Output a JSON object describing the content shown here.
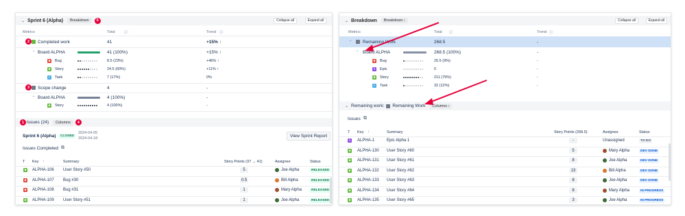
{
  "left": {
    "header": {
      "title": "Sprint 6 (Alpha)",
      "breakdown_label": "Breakdown",
      "collapse_all": "Collapse all",
      "expand_all": "Expand all"
    },
    "badges": {
      "b1": "1",
      "b2": "2",
      "b3": "3",
      "b4": "4",
      "b5": "5"
    },
    "cols": {
      "metrics": "Metrics",
      "total": "Total",
      "trend": "Trend"
    },
    "completed": {
      "label": "Completed work",
      "total": "41",
      "trend": "+15% ↑",
      "board": {
        "label": "Board ALPHA",
        "total": "41 (100%)",
        "trend": "+15% ↑"
      },
      "rows": [
        {
          "label": "Bug",
          "total": "8.5 (23%)",
          "trend": "+46% ↑"
        },
        {
          "label": "Story",
          "total": "24.5 (60%)",
          "trend": "+11% ↑"
        },
        {
          "label": "Task",
          "total": "7 (17%)",
          "trend": "0%"
        }
      ]
    },
    "scope": {
      "label": "Scope change",
      "total": "4",
      "trend": "-",
      "board": {
        "label": "Board ALPHA",
        "total": "4 (100%)",
        "trend": "-"
      },
      "rows": [
        {
          "label": "Story",
          "total": "4 (100%)",
          "trend": "-"
        }
      ]
    },
    "tabs": {
      "issues": "Issues (24)",
      "columns": "Columns"
    },
    "sprint": {
      "name": "Sprint 6 (Alpha)",
      "status": "CLOSED",
      "start": "2024-04-05",
      "end": "2024-04-18",
      "report": "View Sprint Report"
    },
    "completed_title": "Issues Completed",
    "thead": {
      "t": "T",
      "key": "Key",
      "summary": "Summary",
      "points": "Story Points (37 → 41)",
      "assignee": "Assignee",
      "status": "Status"
    },
    "issues": [
      {
        "key": "ALPHA-106",
        "summary": "User Story #50",
        "points": "5",
        "assignee": "Joe Alpha",
        "status": "RELEASED"
      },
      {
        "key": "ALPHA-107",
        "summary": "Bug #30",
        "points": "0.5",
        "assignee": "Bill Alpha",
        "status": "RELEASED"
      },
      {
        "key": "ALPHA-108",
        "summary": "Bug #31",
        "points": "1",
        "assignee": "Mary Alpha",
        "status": "RELEASED"
      },
      {
        "key": "ALPHA-109",
        "summary": "User Story #51",
        "points": "1",
        "assignee": "Joe Alpha",
        "status": "RELEASED"
      }
    ]
  },
  "right": {
    "header": {
      "title": "Breakdown",
      "breakdown_label": "Breakdown",
      "collapse_all": "Collapse all",
      "expand_all": "Expand all"
    },
    "cols": {
      "metrics": "Metrics",
      "total": "Total",
      "trend": "Trend"
    },
    "remaining": {
      "label": "Remaining Work",
      "total": "268.5",
      "trend": "-",
      "board": {
        "label": "Board ALPHA",
        "total": "268.5 (100%)",
        "trend": "-"
      },
      "rows": [
        {
          "label": "Bug",
          "total": "25.5 (9%)",
          "trend": "-"
        },
        {
          "label": "Epic",
          "total": "0",
          "trend": "-"
        },
        {
          "label": "Story",
          "total": "211 (79%)",
          "trend": "-"
        },
        {
          "label": "Task",
          "total": "32 (12%)",
          "trend": "-"
        }
      ]
    },
    "sub": {
      "prefix": "Remaining work:",
      "label": "Remaining Work",
      "columns": "Columns"
    },
    "issues_title": "Issues",
    "thead": {
      "t": "T",
      "key": "Key",
      "summary": "Summary",
      "points": "Story Points (268.5)",
      "assignee": "Assignee",
      "status": "Status"
    },
    "issues": [
      {
        "key": "ALPHA-1",
        "summary": "Epic Alpha 1",
        "points": "-",
        "assignee": "Unassigned",
        "status": "TO DO"
      },
      {
        "key": "ALPHA-130",
        "summary": "User Story #60",
        "points": "5",
        "assignee": "Mary Alpha",
        "status": "DEV DONE"
      },
      {
        "key": "ALPHA-131",
        "summary": "User Story #61",
        "points": "8",
        "assignee": "Joe Alpha",
        "status": "DEV DONE"
      },
      {
        "key": "ALPHA-132",
        "summary": "User Story #62",
        "points": "13",
        "assignee": "Bill Alpha",
        "status": "DEV DONE"
      },
      {
        "key": "ALPHA-133",
        "summary": "User Story #63",
        "points": "8",
        "assignee": "Joe Alpha",
        "status": "DEV DONE"
      },
      {
        "key": "ALPHA-134",
        "summary": "User Story #64",
        "points": "8",
        "assignee": "Mary Alpha",
        "status": "IN PROGRESS"
      },
      {
        "key": "ALPHA-135",
        "summary": "User Story #65",
        "points": "3",
        "assignee": "Joe Alpha",
        "status": "IN PROGRESS"
      }
    ]
  },
  "colors": {
    "accent": "#0c66e4",
    "highlight": "#cfe1f7",
    "annotation_red": "#e5003a",
    "released_bg": "#dcfff1",
    "released_fg": "#216e4e",
    "dev_done_bg": "#e9f2ff",
    "dev_done_fg": "#0055cc",
    "todo_bg": "#f1f2f4",
    "todo_fg": "#44546f"
  },
  "icons": [
    "chevron-down-icon",
    "chevron-right-icon",
    "info-icon",
    "external-link-icon",
    "sort-arrow-icon",
    "bug-icon",
    "story-icon",
    "task-icon",
    "epic-icon"
  ]
}
